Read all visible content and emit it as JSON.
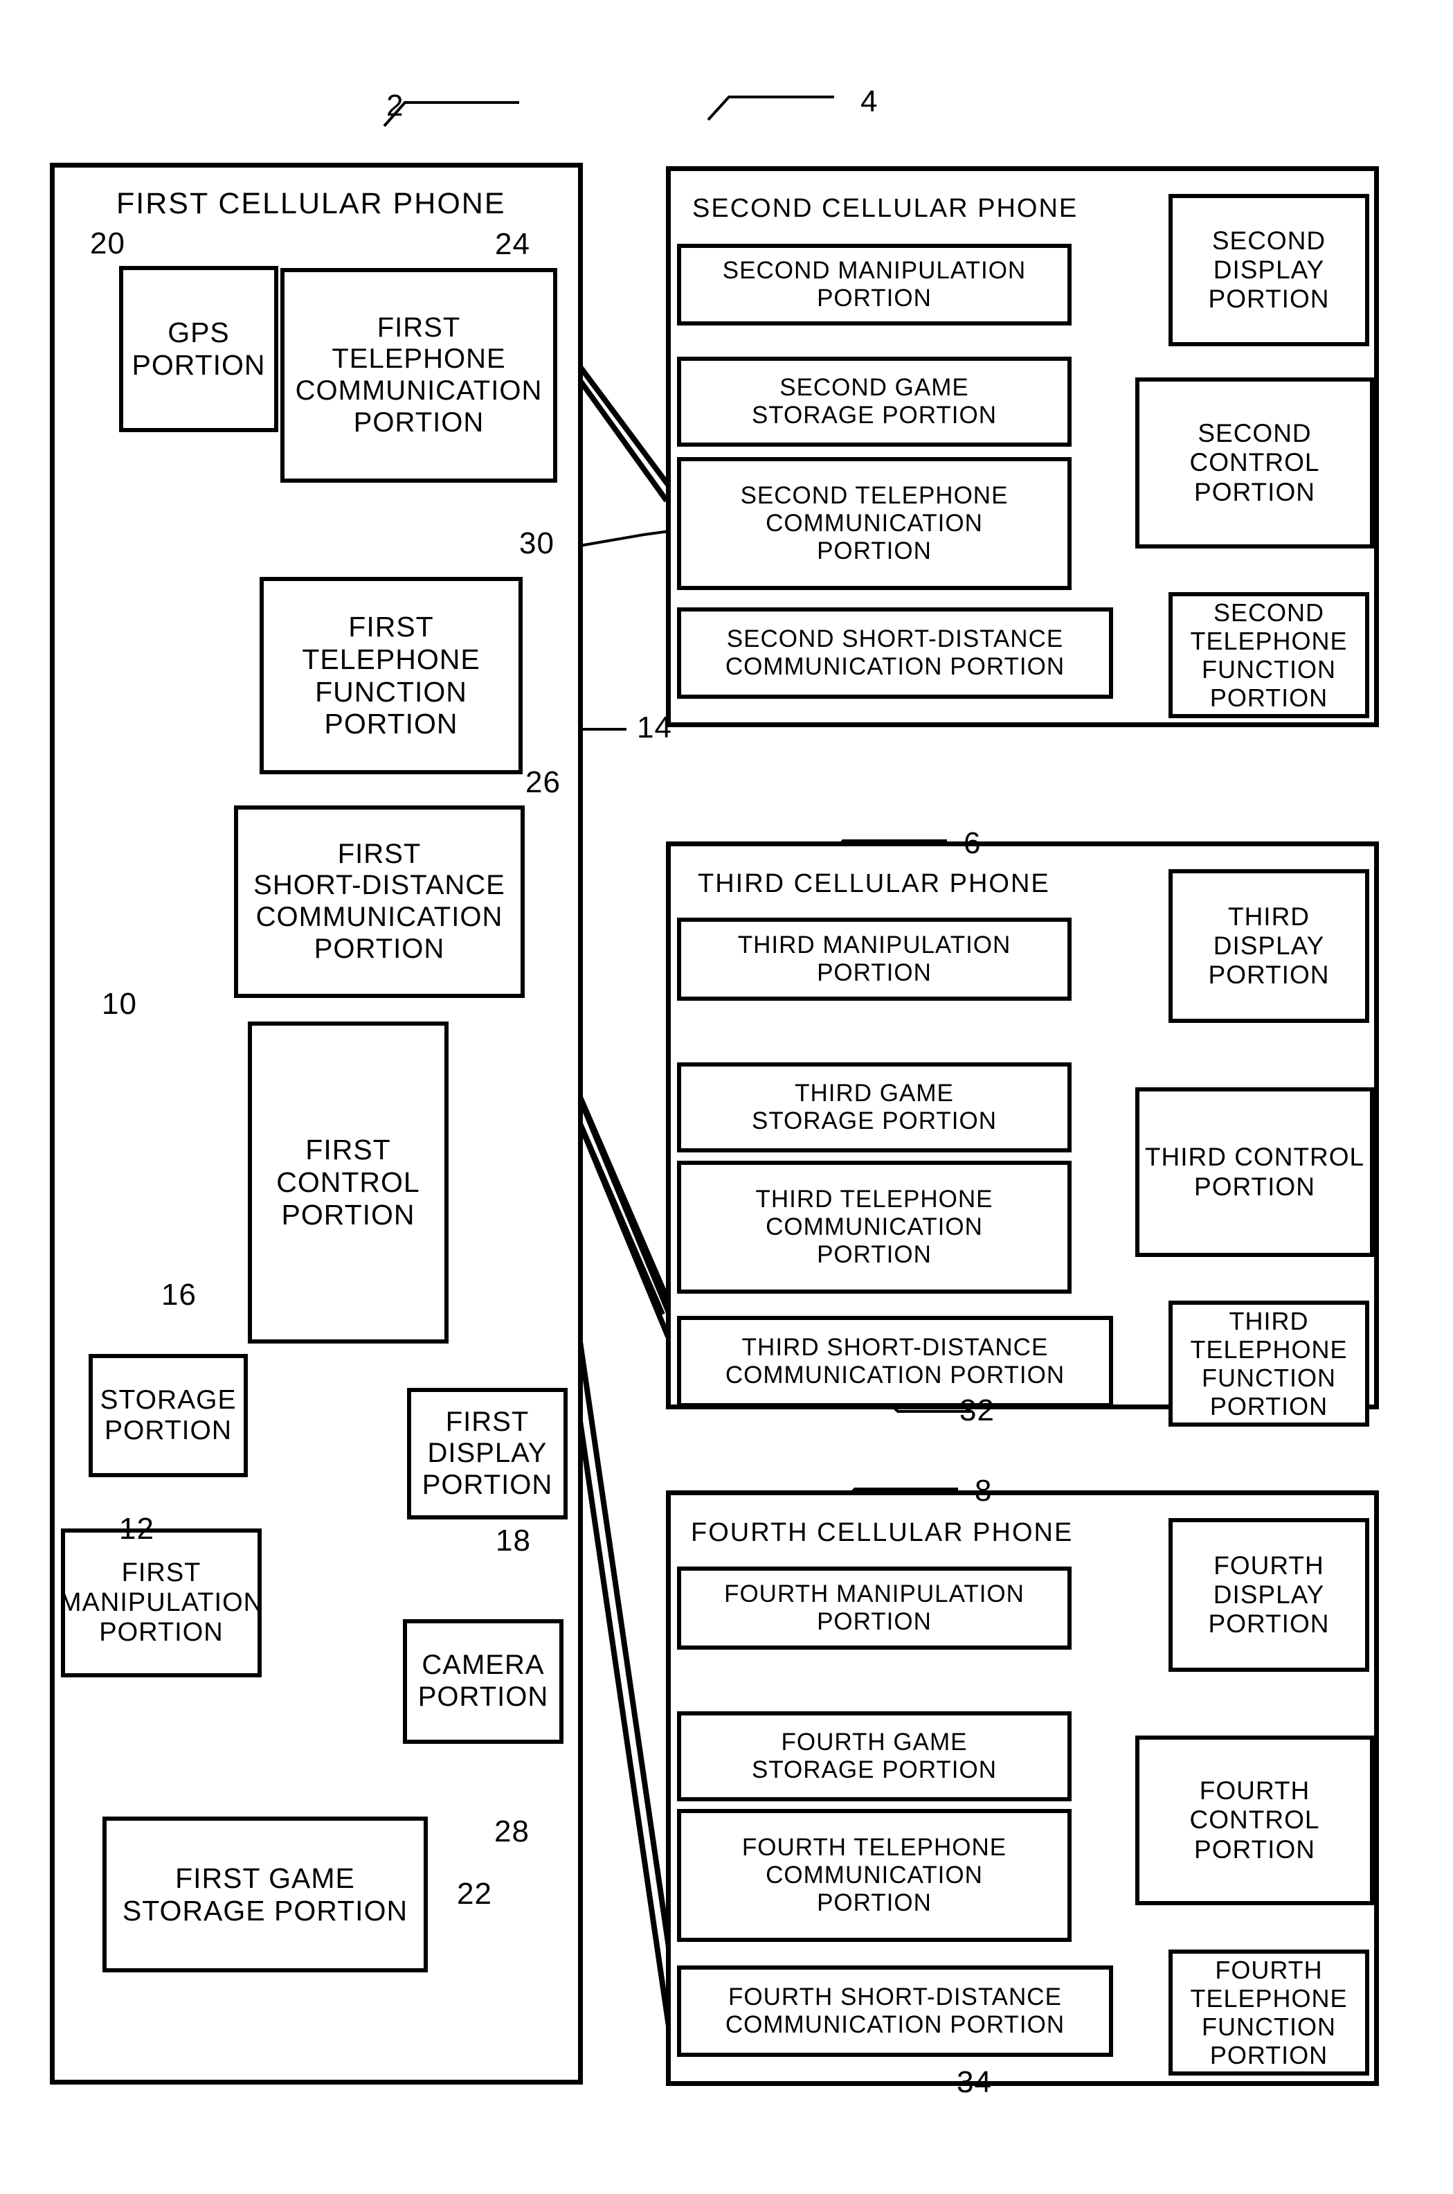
{
  "figure": {
    "type": "patent-block-diagram",
    "description": "Block diagram of four cellular phones with control, communication, display, storage and game-storage portions"
  },
  "phones": {
    "first": {
      "ref": "2",
      "title": "FIRST CELLULAR PHONE",
      "blocks": {
        "gps": {
          "label": "GPS\nPORTION",
          "ref": "20"
        },
        "tel_comm": {
          "label": "FIRST\nTELEPHONE\nCOMMUNICATION\nPORTION",
          "ref": "24"
        },
        "tel_func": {
          "label": "FIRST\nTELEPHONE\nFUNCTION\nPORTION",
          "ref": "14"
        },
        "short_dist": {
          "label": "FIRST\nSHORT-DISTANCE\nCOMMUNICATION\nPORTION",
          "ref": "26"
        },
        "control": {
          "label": "FIRST\nCONTROL\nPORTION",
          "ref": "10"
        },
        "storage": {
          "label": "STORAGE\nPORTION",
          "ref": "16"
        },
        "manipulation": {
          "label": "FIRST\nMANIPULATION\nPORTION",
          "ref": "12"
        },
        "display": {
          "label": "FIRST\nDISPLAY\nPORTION",
          "ref": "18"
        },
        "camera": {
          "label": "CAMERA\nPORTION",
          "ref": "28"
        },
        "game_storage": {
          "label": "FIRST GAME\nSTORAGE PORTION",
          "ref": "22"
        }
      }
    },
    "second": {
      "ref": "4",
      "title": "SECOND CELLULAR PHONE",
      "blocks": {
        "manipulation": {
          "label": "SECOND MANIPULATION\nPORTION"
        },
        "display": {
          "label": "SECOND\nDISPLAY\nPORTION"
        },
        "game_storage": {
          "label": "SECOND GAME\nSTORAGE PORTION"
        },
        "control": {
          "label": "SECOND CONTROL\nPORTION"
        },
        "tel_comm": {
          "label": "SECOND TELEPHONE\nCOMMUNICATION\nPORTION",
          "ref": "30"
        },
        "tel_func": {
          "label": "SECOND\nTELEPHONE\nFUNCTION\nPORTION"
        },
        "short_dist": {
          "label": "SECOND SHORT-DISTANCE\nCOMMUNICATION PORTION"
        }
      }
    },
    "third": {
      "ref": "6",
      "title": "THIRD CELLULAR PHONE",
      "blocks": {
        "manipulation": {
          "label": "THIRD MANIPULATION\nPORTION"
        },
        "display": {
          "label": "THIRD\nDISPLAY\nPORTION"
        },
        "game_storage": {
          "label": "THIRD GAME\nSTORAGE PORTION"
        },
        "control": {
          "label": "THIRD CONTROL\nPORTION"
        },
        "tel_comm": {
          "label": "THIRD TELEPHONE\nCOMMUNICATION\nPORTION"
        },
        "tel_func": {
          "label": "THIRD\nTELEPHONE\nFUNCTION\nPORTION"
        },
        "short_dist": {
          "label": "THIRD SHORT-DISTANCE\nCOMMUNICATION PORTION",
          "ref": "32"
        }
      }
    },
    "fourth": {
      "ref": "8",
      "title": "FOURTH CELLULAR PHONE",
      "blocks": {
        "manipulation": {
          "label": "FOURTH MANIPULATION\nPORTION"
        },
        "display": {
          "label": "FOURTH\nDISPLAY\nPORTION"
        },
        "game_storage": {
          "label": "FOURTH GAME\nSTORAGE PORTION"
        },
        "control": {
          "label": "FOURTH CONTROL\nPORTION"
        },
        "tel_comm": {
          "label": "FOURTH TELEPHONE\nCOMMUNICATION\nPORTION"
        },
        "tel_func": {
          "label": "FOURTH\nTELEPHONE\nFUNCTION\nPORTION"
        },
        "short_dist": {
          "label": "FOURTH SHORT-DISTANCE\nCOMMUNICATION PORTION",
          "ref": "34"
        }
      }
    }
  },
  "reference_numerals": {
    "n2": "2",
    "n4": "4",
    "n6": "6",
    "n8": "8",
    "n10": "10",
    "n12": "12",
    "n14": "14",
    "n16": "16",
    "n18": "18",
    "n20": "20",
    "n22": "22",
    "n24": "24",
    "n26": "26",
    "n28": "28",
    "n30": "30",
    "n32": "32",
    "n34": "34"
  },
  "colors": {
    "ink": "#000000",
    "paper": "#ffffff"
  }
}
